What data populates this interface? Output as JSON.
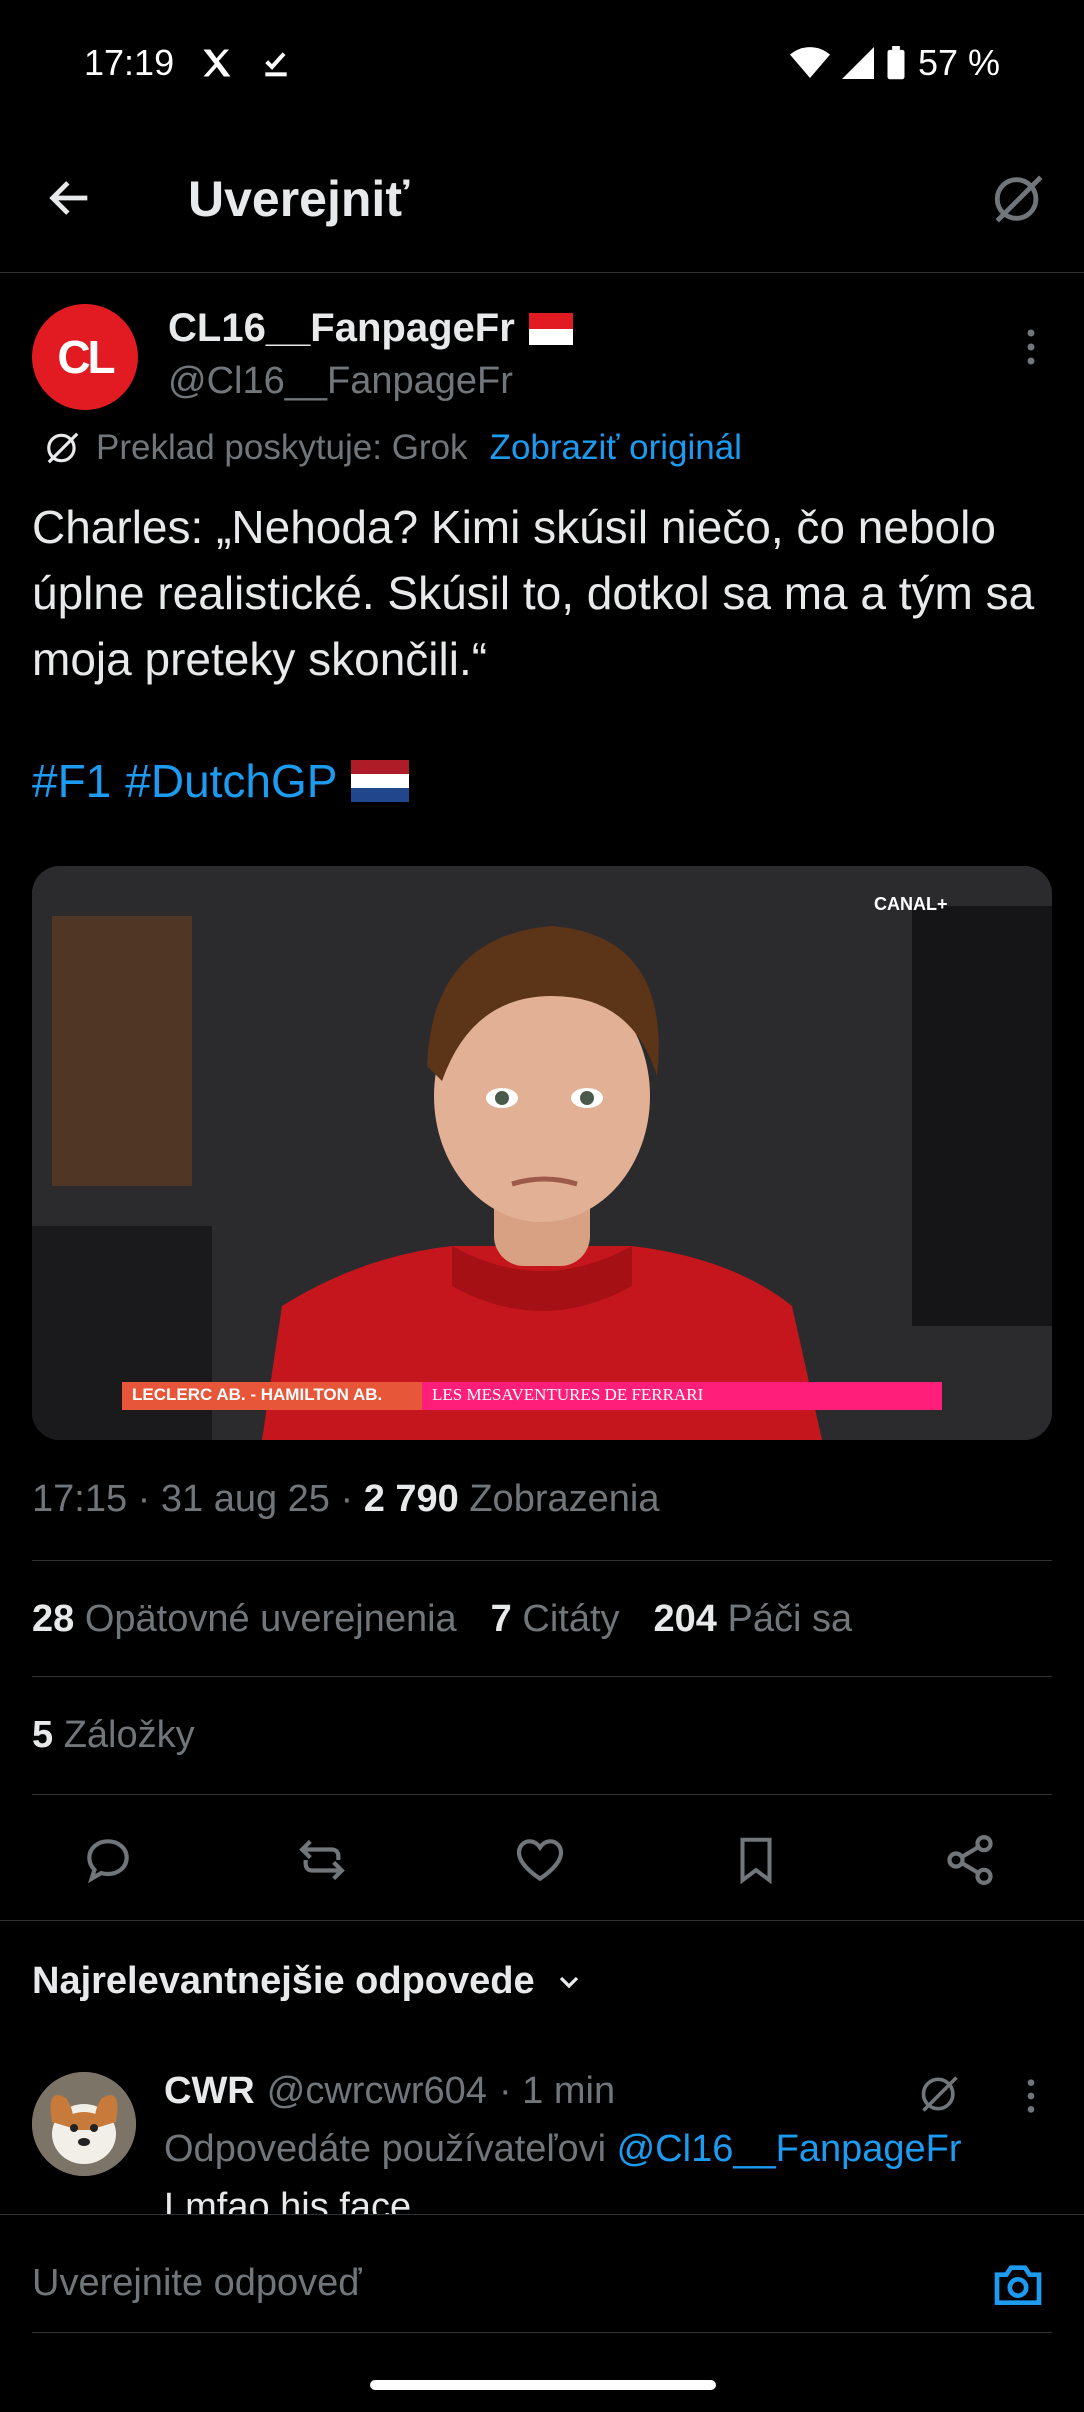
{
  "status_bar": {
    "time": "17:19",
    "battery": "57 %"
  },
  "header": {
    "title": "Uverejniť"
  },
  "post": {
    "author_name": "CL16__FanpageFr",
    "author_handle": "@Cl16__FanpageFr",
    "avatar_text": "CL",
    "translation_note": "Preklad poskytuje: Grok",
    "show_original": "Zobraziť originál",
    "text": "Charles: „Nehoda? Kimi skúsil niečo, čo nebolo úplne realistické. Skúsil to, dotkol sa ma a tým sa moja preteky skončili.“",
    "hashtags": [
      "#F1",
      "#DutchGP"
    ],
    "media": {
      "channel": "CANAL+",
      "lower_third_left": "LECLERC AB. - HAMILTON AB.",
      "lower_third_right": "LES MESAVENTURES DE FERRARI"
    },
    "timestamp": "17:15 · 31 aug 25 · ",
    "views_count": "2 790",
    "views_label": "Zobrazenia",
    "reposts_count": "28",
    "reposts_label": "Opätovné uverejnenia",
    "quotes_count": "7",
    "quotes_label": "Citáty",
    "likes_count": "204",
    "likes_label": "Páči sa",
    "bookmarks_count": "5",
    "bookmarks_label": "Záložky"
  },
  "replies": {
    "sort_label": "Najrelevantnejšie odpovede",
    "items": [
      {
        "name": "CWR",
        "handle": "@cwrcwr604",
        "time": "· 1 min",
        "replying_prefix": "Odpovedáte používateľovi",
        "replying_to": "@Cl16__FanpageFr",
        "text": "Lmfao his face"
      }
    ]
  },
  "compose": {
    "placeholder": "Uverejnite odpoveď"
  },
  "colors": {
    "accent": "#1d9bf0",
    "background": "#000000",
    "muted": "#71767b",
    "avatar_red": "#e21b23"
  }
}
